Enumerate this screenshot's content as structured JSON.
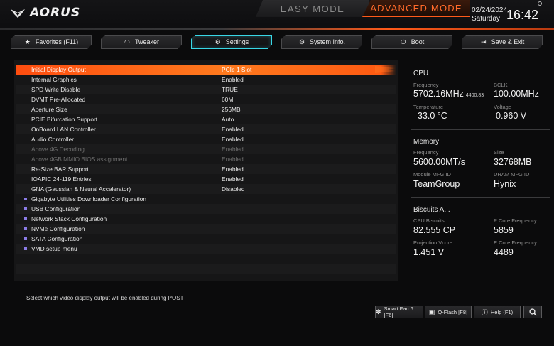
{
  "header": {
    "logo_text": "AORUS",
    "mode_easy": "EASY MODE",
    "mode_advanced": "ADVANCED MODE",
    "date": "02/24/2024",
    "day": "Saturday",
    "time": "16:42"
  },
  "tabs": [
    {
      "label": "Favorites (F11)",
      "icon": "star-folder-icon"
    },
    {
      "label": "Tweaker",
      "icon": "gauge-icon"
    },
    {
      "label": "Settings",
      "icon": "gear-icon",
      "active": true
    },
    {
      "label": "System Info.",
      "icon": "info-gear-icon"
    },
    {
      "label": "Boot",
      "icon": "power-icon"
    },
    {
      "label": "Save & Exit",
      "icon": "exit-icon"
    }
  ],
  "settings": [
    {
      "label": "Initial Display Output",
      "value": "PCIe 1 Slot"
    },
    {
      "label": "Internal Graphics",
      "value": "Enabled"
    },
    {
      "label": "SPD Write Disable",
      "value": "TRUE"
    },
    {
      "label": "DVMT Pre-Allocated",
      "value": "60M"
    },
    {
      "label": "Aperture Size",
      "value": "256MB"
    },
    {
      "label": "PCIE Bifurcation Support",
      "value": "Auto"
    },
    {
      "label": "OnBoard LAN Controller",
      "value": "Enabled"
    },
    {
      "label": "Audio Controller",
      "value": "Enabled"
    },
    {
      "label": "Above 4G Decoding",
      "value": "Enabled"
    },
    {
      "label": "Above 4GB MMIO BIOS assignment",
      "value": "Enabled"
    },
    {
      "label": "Re-Size BAR Support",
      "value": "Enabled"
    },
    {
      "label": "IOAPIC 24-119 Entries",
      "value": "Enabled"
    },
    {
      "label": "GNA (Gaussian & Neural Accelerator)",
      "value": "Disabled"
    }
  ],
  "submenus": [
    "Gigabyte Utilities Downloader Configuration",
    "USB Configuration",
    "Network Stack Configuration",
    "NVMe Configuration",
    "SATA Configuration",
    "VMD setup menu"
  ],
  "help_text": "Select which video display output will be enabled during POST",
  "info": {
    "cpu": {
      "title": "CPU",
      "frequency_label": "Frequency",
      "frequency": "5702.16MHz",
      "frequency_small": "4400.83",
      "bclk_label": "BCLK",
      "bclk": "100.00MHz",
      "temperature_label": "Temperature",
      "temperature": "33.0 °C",
      "voltage_label": "Voltage",
      "voltage": "0.960 V"
    },
    "memory": {
      "title": "Memory",
      "frequency_label": "Frequency",
      "frequency": "5600.00MT/s",
      "size_label": "Size",
      "size": "32768MB",
      "module_label": "Module MFG ID",
      "module": "TeamGroup",
      "dram_label": "DRAM MFG ID",
      "dram": "Hynix"
    },
    "biscuits": {
      "title": "Biscuits A.I.",
      "cpu_biscuits_label": "CPU Biscuits",
      "cpu_biscuits": "82.555 CP",
      "pcore_label": "P Core Frequency",
      "pcore": "5859",
      "vcore_label": "Projection Vcore",
      "vcore": "1.451 V",
      "ecore_label": "E Core Frequency",
      "ecore": "4489"
    }
  },
  "bottom": {
    "smart_fan": "Smart Fan 6 [F6]",
    "qflash": "Q-Flash [F8]",
    "help": "Help (F1)"
  },
  "colors": {
    "accent_orange": "#ff5a1a",
    "active_tab_cyan": "#39d7e6",
    "submenu_bullet": "#8a7be6"
  }
}
